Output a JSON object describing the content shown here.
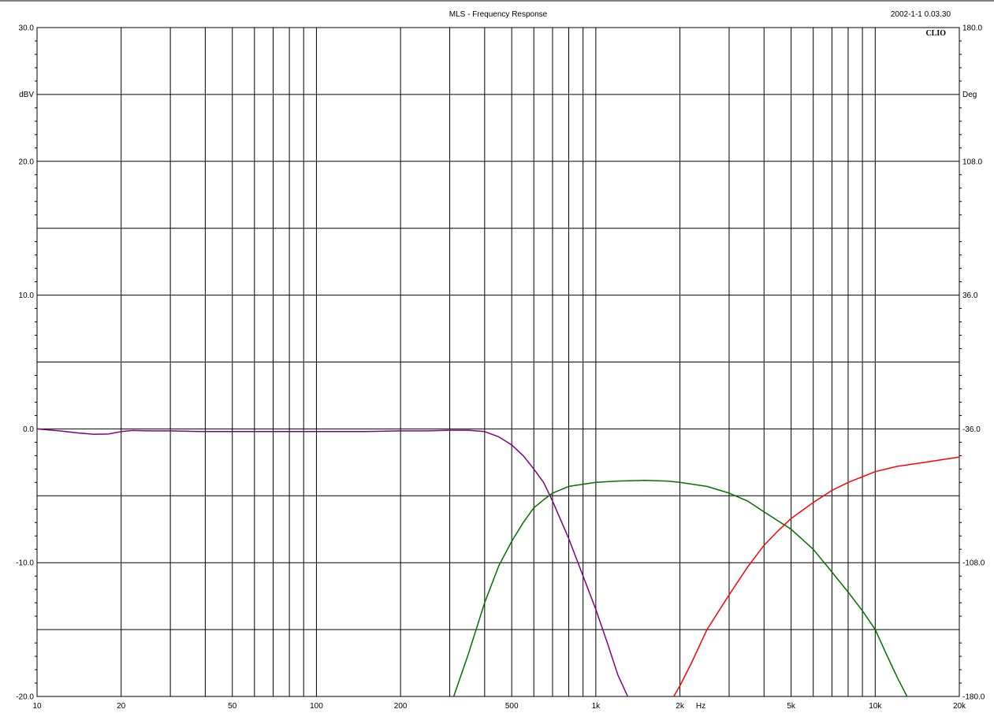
{
  "header": {
    "title": "MLS - Frequency Response",
    "timestamp": "2002-1-1 0.03.30",
    "logo": "CLIO"
  },
  "chart_data": {
    "type": "line",
    "title": "MLS - Frequency Response",
    "xlabel": "Hz",
    "ylabel_left": "dBV",
    "ylabel_right": "Deg",
    "x_scale": "log",
    "xlim": [
      10,
      20000
    ],
    "ylim_left": [
      -20,
      30
    ],
    "ylim_right": [
      -180,
      180
    ],
    "grid": true,
    "x_ticks": [
      {
        "value": 10,
        "label": "10"
      },
      {
        "value": 20,
        "label": "20"
      },
      {
        "value": 50,
        "label": "50"
      },
      {
        "value": 100,
        "label": "100"
      },
      {
        "value": 200,
        "label": "200"
      },
      {
        "value": 500,
        "label": "500"
      },
      {
        "value": 1000,
        "label": "1k"
      },
      {
        "value": 2000,
        "label": "2k"
      },
      {
        "value": 5000,
        "label": "5k"
      },
      {
        "value": 10000,
        "label": "10k"
      },
      {
        "value": 20000,
        "label": "20k"
      }
    ],
    "y_ticks_left": [
      {
        "value": 30,
        "label": "30.0"
      },
      {
        "value": 20,
        "label": "20.0"
      },
      {
        "value": 10,
        "label": "10.0"
      },
      {
        "value": 0,
        "label": "0.0"
      },
      {
        "value": -10,
        "label": "-10.0"
      },
      {
        "value": -20,
        "label": "-20.0"
      }
    ],
    "y_ticks_right": [
      {
        "value": 180,
        "label": "180.0"
      },
      {
        "value": 108,
        "label": "108.0"
      },
      {
        "value": 36,
        "label": "36.0"
      },
      {
        "value": -36,
        "label": "-36.0"
      },
      {
        "value": -108,
        "label": "-108.0"
      },
      {
        "value": -180,
        "label": "-180.0"
      }
    ],
    "series": [
      {
        "color": "#800080",
        "points": [
          [
            10,
            0.0
          ],
          [
            12,
            -0.15
          ],
          [
            14,
            -0.3
          ],
          [
            16,
            -0.4
          ],
          [
            18,
            -0.38
          ],
          [
            20,
            -0.2
          ],
          [
            22,
            -0.12
          ],
          [
            25,
            -0.15
          ],
          [
            30,
            -0.15
          ],
          [
            40,
            -0.2
          ],
          [
            50,
            -0.2
          ],
          [
            70,
            -0.2
          ],
          [
            100,
            -0.2
          ],
          [
            150,
            -0.2
          ],
          [
            200,
            -0.15
          ],
          [
            250,
            -0.15
          ],
          [
            300,
            -0.1
          ],
          [
            350,
            -0.1
          ],
          [
            400,
            -0.2
          ],
          [
            450,
            -0.6
          ],
          [
            500,
            -1.2
          ],
          [
            550,
            -2.0
          ],
          [
            600,
            -3.0
          ],
          [
            650,
            -4.0
          ],
          [
            700,
            -5.4
          ],
          [
            800,
            -8.2
          ],
          [
            900,
            -11.0
          ],
          [
            1000,
            -13.5
          ],
          [
            1100,
            -16.0
          ],
          [
            1200,
            -18.4
          ],
          [
            1300,
            -20.0
          ]
        ]
      },
      {
        "color": "#007000",
        "points": [
          [
            310,
            -20.0
          ],
          [
            350,
            -16.8
          ],
          [
            400,
            -13.0
          ],
          [
            450,
            -10.2
          ],
          [
            500,
            -8.4
          ],
          [
            550,
            -7.0
          ],
          [
            600,
            -5.9
          ],
          [
            650,
            -5.3
          ],
          [
            700,
            -4.8
          ],
          [
            800,
            -4.3
          ],
          [
            1000,
            -4.0
          ],
          [
            1200,
            -3.9
          ],
          [
            1500,
            -3.85
          ],
          [
            1800,
            -3.9
          ],
          [
            2000,
            -4.0
          ],
          [
            2500,
            -4.3
          ],
          [
            3000,
            -4.8
          ],
          [
            3500,
            -5.4
          ],
          [
            4000,
            -6.2
          ],
          [
            5000,
            -7.5
          ],
          [
            6000,
            -9.0
          ],
          [
            7000,
            -10.7
          ],
          [
            8000,
            -12.2
          ],
          [
            9000,
            -13.6
          ],
          [
            10000,
            -15.0
          ],
          [
            11000,
            -16.9
          ],
          [
            12000,
            -18.6
          ],
          [
            13000,
            -20.0
          ]
        ]
      },
      {
        "color": "#ff0000",
        "points": [
          [
            1900,
            -20.0
          ],
          [
            2000,
            -19.2
          ],
          [
            2200,
            -17.5
          ],
          [
            2500,
            -15.0
          ],
          [
            3000,
            -12.4
          ],
          [
            3500,
            -10.3
          ],
          [
            4000,
            -8.7
          ],
          [
            4500,
            -7.6
          ],
          [
            5000,
            -6.7
          ],
          [
            6000,
            -5.5
          ],
          [
            7000,
            -4.6
          ],
          [
            8000,
            -4.0
          ],
          [
            10000,
            -3.2
          ],
          [
            12000,
            -2.8
          ],
          [
            15000,
            -2.5
          ],
          [
            20000,
            -2.1
          ]
        ]
      }
    ]
  }
}
